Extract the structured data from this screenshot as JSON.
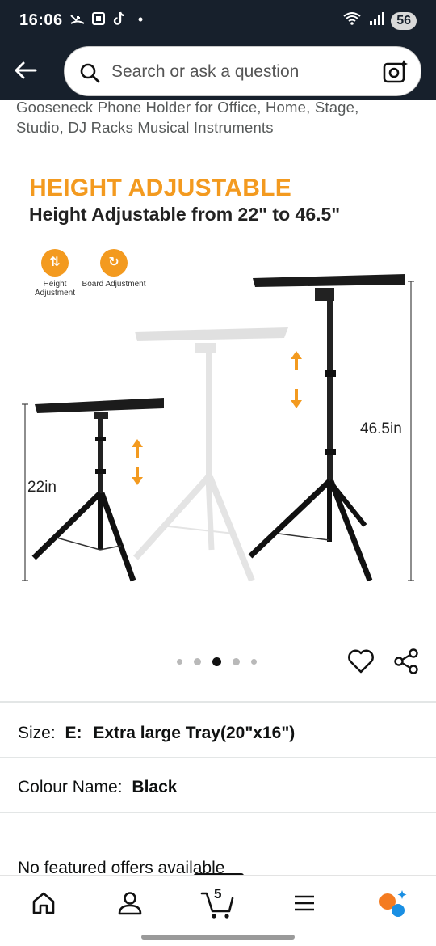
{
  "status_bar": {
    "time": "16:06",
    "dot": "•",
    "battery": "56",
    "icons": [
      "missed-call-icon",
      "screenshot-icon",
      "tiktok-icon",
      "wifi-icon",
      "signal-icon"
    ]
  },
  "header": {
    "search_placeholder": "Search or ask a question",
    "icons": [
      "back-arrow-icon",
      "search-icon",
      "camera-lens-icon"
    ]
  },
  "product": {
    "title_line1": "Gooseneck Phone Holder for Office, Home, Stage,",
    "title_line2": "Studio, DJ Racks Musical Instruments",
    "image": {
      "headline": "HEIGHT ADJUSTABLE",
      "subheadline": "Height Adjustable from 22\" to 46.5\"",
      "feature1": "Height Adjustment",
      "feature2": "Board Adjustment",
      "short_height": "22in",
      "tall_height": "46.5in"
    },
    "carousel": {
      "total": 5,
      "active_index": 2
    }
  },
  "variations": {
    "size_label": "Size:",
    "size_code": "E:",
    "size_value": "Extra large Tray(20\"x16\")",
    "colour_label": "Colour Name:",
    "colour_value": "Black"
  },
  "offers_text": "No featured offers available",
  "bottom_nav": {
    "cart_count": "5",
    "items": [
      "home-icon",
      "account-icon",
      "cart-icon",
      "menu-icon",
      "rufus-assistant-icon"
    ]
  },
  "colors": {
    "header_bg": "#17202c",
    "accent_orange": "#f39a1f"
  }
}
